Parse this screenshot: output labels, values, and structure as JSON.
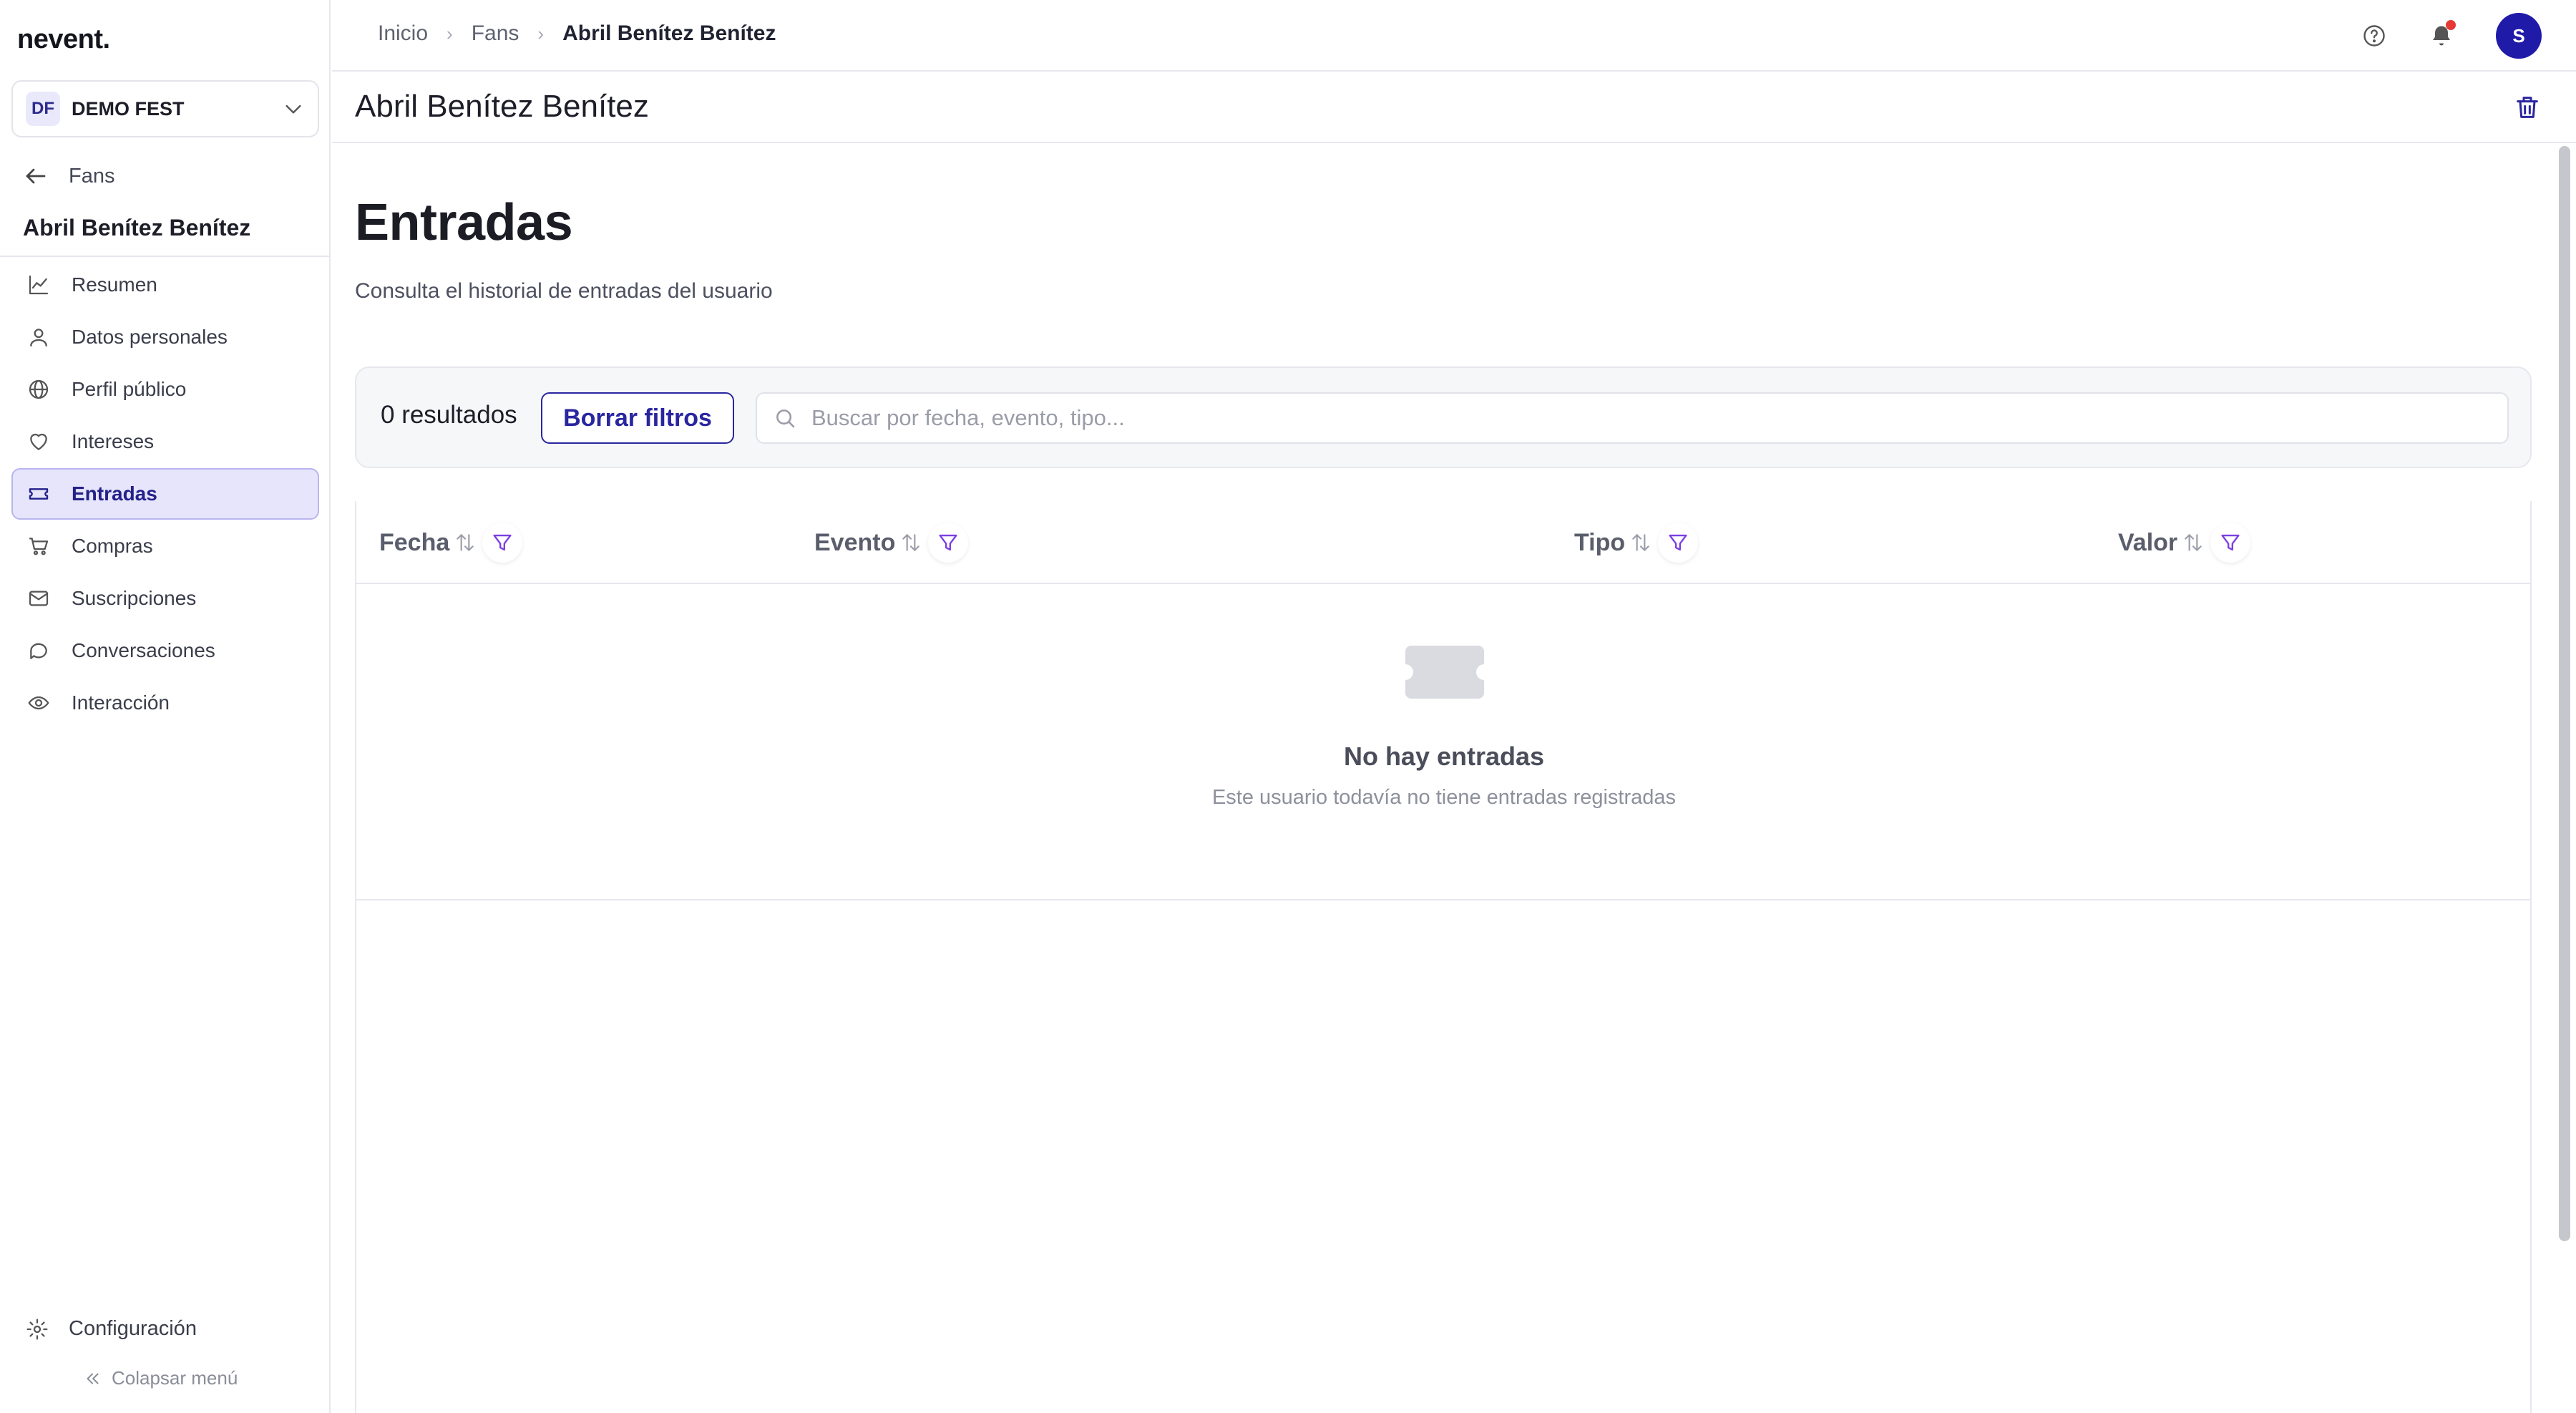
{
  "app": {
    "logo": "nevent."
  },
  "org": {
    "badge": "DF",
    "name": "DEMO FEST"
  },
  "sidebar": {
    "back_label": "Fans",
    "user_name": "Abril Benítez Benítez",
    "items": [
      {
        "label": "Resumen",
        "icon": "chart-line-icon"
      },
      {
        "label": "Datos personales",
        "icon": "user-icon"
      },
      {
        "label": "Perfil público",
        "icon": "globe-icon"
      },
      {
        "label": "Intereses",
        "icon": "heart-icon"
      },
      {
        "label": "Entradas",
        "icon": "ticket-icon",
        "active": true
      },
      {
        "label": "Compras",
        "icon": "cart-icon"
      },
      {
        "label": "Suscripciones",
        "icon": "mail-icon"
      },
      {
        "label": "Conversaciones",
        "icon": "chat-icon"
      },
      {
        "label": "Interacción",
        "icon": "eye-icon"
      }
    ],
    "config_label": "Configuración",
    "collapse_label": "Colapsar menú"
  },
  "breadcrumb": {
    "items": [
      "Inicio",
      "Fans",
      "Abril Benítez Benítez"
    ]
  },
  "topbar": {
    "avatar_initial": "S"
  },
  "page": {
    "title": "Abril Benítez Benítez",
    "section_title": "Entradas",
    "section_subtitle": "Consulta el historial de entradas del usuario"
  },
  "filters": {
    "result_count": "0 resultados",
    "clear_label": "Borrar filtros",
    "search_placeholder": "Buscar por fecha, evento, tipo..."
  },
  "table": {
    "columns": [
      "Fecha",
      "Evento",
      "Tipo",
      "Valor"
    ],
    "empty_title": "No hay entradas",
    "empty_subtitle": "Este usuario todavía no tiene entradas registradas"
  },
  "colors": {
    "accent": "#2a26a0",
    "active_bg": "#e6e5fb",
    "filter_icon": "#7b3fe4",
    "notification": "#e53935"
  }
}
